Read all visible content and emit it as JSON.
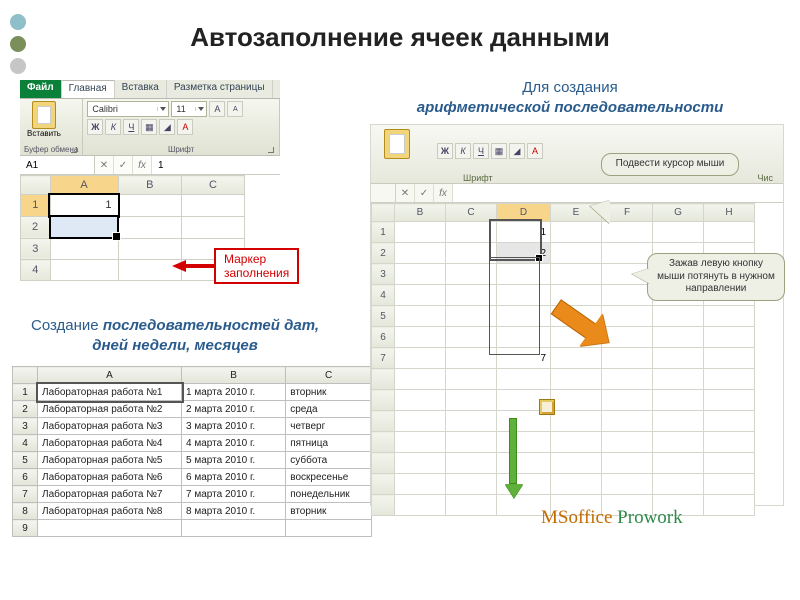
{
  "title": "Автозаполнение  ячеек  данными",
  "decor_dots": [
    "#8fbfc9",
    "#7b8f5a",
    "#c6c6c6"
  ],
  "shot1": {
    "tabs": {
      "file": "Файл",
      "home": "Главная",
      "insert": "Вставка",
      "pagelayout": "Разметка страницы"
    },
    "ribbon": {
      "paste_label": "Вставить",
      "clipboard_group": "Буфер обмена",
      "font_group": "Шрифт",
      "font_name": "Calibri",
      "font_size": "11",
      "btn_bold": "Ж",
      "btn_italic": "К",
      "btn_underline": "Ч",
      "btn_grow": "A",
      "btn_shrink": "A"
    },
    "namebox": "A1",
    "fx_label": "fx",
    "fx_value": "1",
    "columns": [
      "A",
      "B",
      "C"
    ],
    "rows": [
      {
        "n": "1",
        "A": "1",
        "B": "",
        "C": ""
      },
      {
        "n": "2",
        "A": "",
        "B": "",
        "C": ""
      },
      {
        "n": "3",
        "A": "",
        "B": "",
        "C": ""
      },
      {
        "n": "4",
        "A": "",
        "B": "",
        "C": ""
      }
    ],
    "marker_label": "Маркер\nзаполнения"
  },
  "subtitle1": {
    "line1": "Создание ",
    "ital": "последовательностей дат, дней недели, месяцев"
  },
  "subtitle2": {
    "line1": "Для создания",
    "ital": "арифметической последовательности"
  },
  "shot3": {
    "columns": [
      "",
      "A",
      "B",
      "C"
    ],
    "rows": [
      {
        "n": "1",
        "A": "Лабораторная работа №1",
        "B": "1 марта 2010 г.",
        "C": "вторник"
      },
      {
        "n": "2",
        "A": "Лабораторная работа №2",
        "B": "2 марта 2010 г.",
        "C": "среда"
      },
      {
        "n": "3",
        "A": "Лабораторная работа №3",
        "B": "3 марта 2010 г.",
        "C": "четверг"
      },
      {
        "n": "4",
        "A": "Лабораторная работа №4",
        "B": "4 марта 2010 г.",
        "C": "пятница"
      },
      {
        "n": "5",
        "A": "Лабораторная работа №5",
        "B": "5 марта 2010 г.",
        "C": "суббота"
      },
      {
        "n": "6",
        "A": "Лабораторная работа №6",
        "B": "6 марта 2010 г.",
        "C": "воскресенье"
      },
      {
        "n": "7",
        "A": "Лабораторная работа №7",
        "B": "7 марта 2010 г.",
        "C": "понедельник"
      },
      {
        "n": "8",
        "A": "Лабораторная работа №8",
        "B": "8 марта 2010 г.",
        "C": "вторник"
      }
    ],
    "blank_row": "9"
  },
  "shot2": {
    "ribbon": {
      "font_group": "Шрифт",
      "num_group": "Чис",
      "btn_bold": "Ж",
      "btn_italic": "К",
      "btn_underline": "Ч"
    },
    "namebox_fx": "fx",
    "columns": [
      "B",
      "C",
      "D",
      "E",
      "F",
      "G",
      "H"
    ],
    "highlighted_col": "D",
    "rows": [
      "1",
      "2",
      "3",
      "4",
      "5",
      "6",
      "7"
    ],
    "cells": {
      "D1": "1",
      "D2": "2",
      "D7": "7"
    },
    "speech1": "Подвести курсор мыши",
    "speech2": "Зажав левую кнопку мыши потянуть в нужном направлении",
    "watermark_ms": "MSoffice ",
    "watermark_pw": "Prowork"
  }
}
